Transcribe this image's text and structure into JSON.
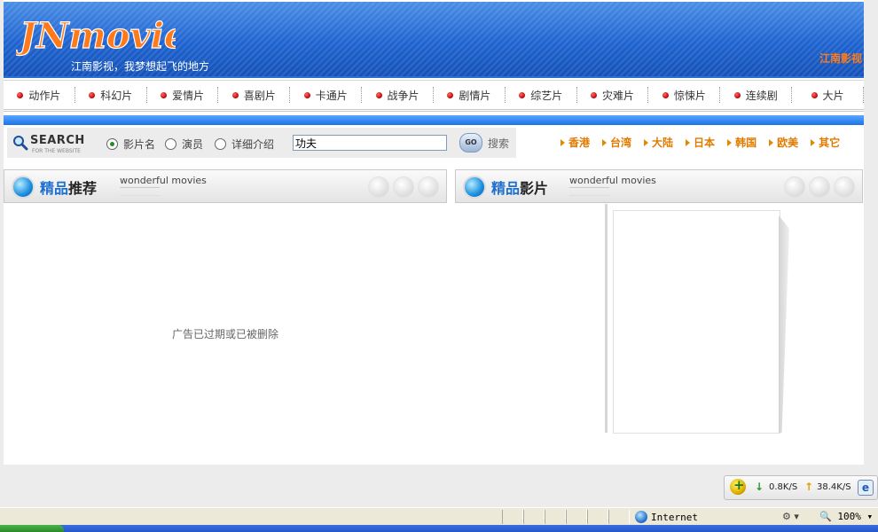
{
  "header": {
    "logo_text": "JNmovie",
    "slogan": "江南影视，我梦想起飞的地方",
    "right_text": "江南影视"
  },
  "nav": {
    "items": [
      "动作片",
      "科幻片",
      "爱情片",
      "喜剧片",
      "卡通片",
      "战争片",
      "剧情片",
      "综艺片",
      "灾难片",
      "惊悚片",
      "连续剧",
      "大片"
    ]
  },
  "search": {
    "logo_title": "SEARCH",
    "logo_sub": "FOR THE WEBSITE",
    "options": [
      {
        "label": "影片名",
        "checked": true
      },
      {
        "label": "演员",
        "checked": false
      },
      {
        "label": "详细介绍",
        "checked": false
      }
    ],
    "keyword_value": "功夫",
    "go_label": "GO",
    "submit_label": "搜索"
  },
  "regions": [
    "香港",
    "台湾",
    "大陆",
    "日本",
    "韩国",
    "欧美",
    "其它"
  ],
  "panels": {
    "left": {
      "title_blue": "精品",
      "title_black": "推荐",
      "subtitle": "wonderful movies"
    },
    "right": {
      "title_blue": "精品",
      "title_black": "影片",
      "subtitle": "wonderful movies"
    }
  },
  "ad": {
    "text": "广告已过期或已被删除"
  },
  "netspeed": {
    "down": "0.8K/S",
    "up": "38.4K/S"
  },
  "statusbar": {
    "zone": "Internet",
    "zoom": "100%"
  }
}
